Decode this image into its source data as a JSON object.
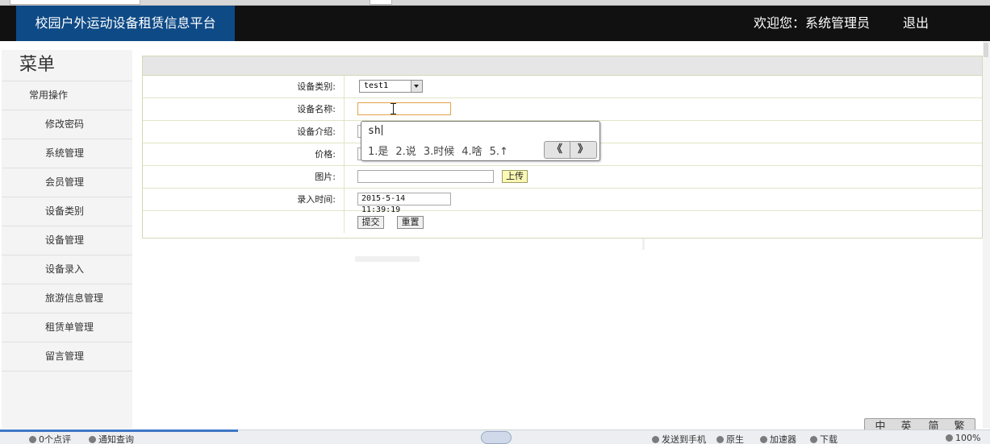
{
  "header": {
    "title": "校园户外运动设备租赁信息平台",
    "welcome": "欢迎您：系统管理员",
    "logout": "退出"
  },
  "sidebar": {
    "title": "菜单",
    "section": "常用操作",
    "items": [
      {
        "label": "修改密码"
      },
      {
        "label": "系统管理"
      },
      {
        "label": "会员管理"
      },
      {
        "label": "设备类别"
      },
      {
        "label": "设备管理"
      },
      {
        "label": "设备录入"
      },
      {
        "label": "旅游信息管理"
      },
      {
        "label": "租赁单管理"
      },
      {
        "label": "留言管理"
      }
    ]
  },
  "form": {
    "category_label": "设备类别:",
    "category_value": "test1",
    "name_label": "设备名称:",
    "intro_label": "设备介绍:",
    "price_label": "价格:",
    "image_label": "图片:",
    "upload_label": "上传",
    "time_label": "录入时间:",
    "time_value": "2015-5-14 11:39:19",
    "submit_label": "提交",
    "reset_label": "重置"
  },
  "ime": {
    "composition": "sh",
    "candidates": [
      "1.是",
      "2.说",
      "3.时候",
      "4.啥",
      "5.↑"
    ],
    "prev_page": "《",
    "next_page": "》"
  },
  "lang_toolbar": [
    "中",
    "英",
    "简",
    "繁"
  ],
  "statusbar": {
    "comments": "0个点评",
    "status_text": "通知查询",
    "send_phone": "发送到手机",
    "fullscreen": "原生",
    "speedup": "加速器",
    "download": "下载",
    "zoom": "100%"
  },
  "colors": {
    "header_bg": "#111111",
    "brand_bg": "#0e4a86",
    "panel_border": "#d6d8b8",
    "upload_bg": "#fbf9b5"
  }
}
